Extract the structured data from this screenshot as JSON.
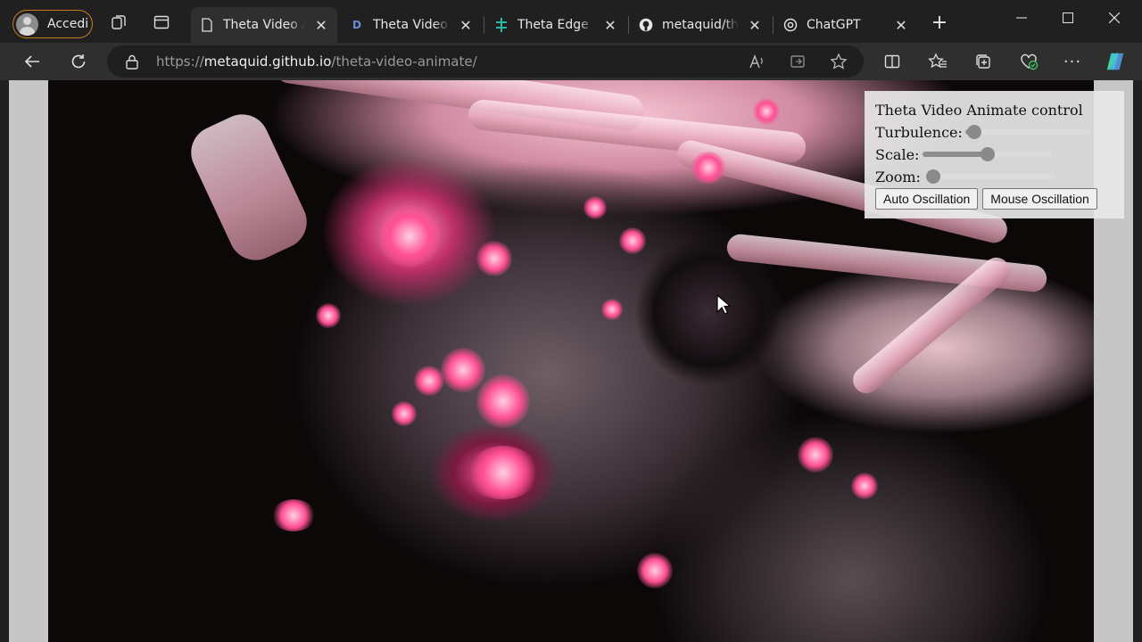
{
  "profile": {
    "label": "Accedi"
  },
  "tabs": [
    {
      "title": "Theta Video Animate",
      "favicon": "page-icon",
      "active": true
    },
    {
      "title": "Theta Video Animate",
      "favicon": "d-logo-icon",
      "favicon_text": "D"
    },
    {
      "title": "Theta Edge Cloud",
      "favicon": "theta-logo-icon"
    },
    {
      "title": "metaquid/theta-video-animate",
      "favicon": "github-icon"
    },
    {
      "title": "ChatGPT",
      "favicon": "chatgpt-icon"
    }
  ],
  "address": {
    "scheme": "https://",
    "host": "metaquid.github.io",
    "path": "/theta-video-animate/"
  },
  "panel": {
    "title": "Theta Video Animate control",
    "turbulence": {
      "label": "Turbulence:",
      "value": 0.02
    },
    "scale": {
      "label": "Scale:",
      "value": 0.5
    },
    "zoom": {
      "label": "Zoom:",
      "value": 0.0
    },
    "auto_button": "Auto Oscillation",
    "mouse_button": "Mouse Oscillation"
  },
  "colors": {
    "accent_profile": "#c77d1c",
    "tab_active": "#2f2f2f",
    "chrome": "#202020"
  }
}
